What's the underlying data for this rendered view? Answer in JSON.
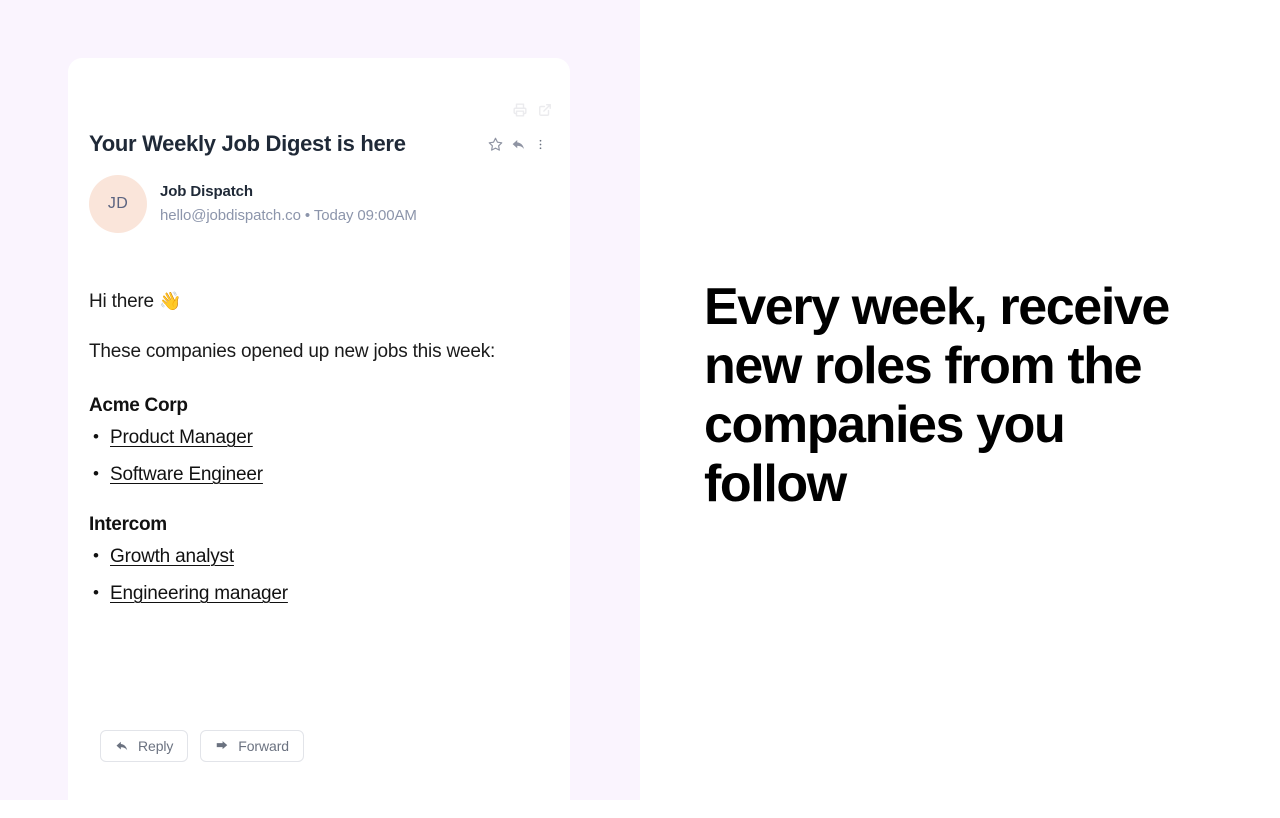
{
  "theme": {
    "left_background": "#faf4fe",
    "right_background": "#ffffff",
    "card_background": "#ffffff",
    "avatar_background": "#fae5da",
    "avatar_text_color": "#5b6480",
    "title_color": "#1f2937",
    "muted_text_color": "#8c95ab",
    "body_text_color": "#1a1a1a",
    "headline_color": "#000000",
    "button_border_color": "#e2e4e9",
    "button_text_color": "#6b7280",
    "utility_icon_color": "#ebebee"
  },
  "email": {
    "title": "Your Weekly Job Digest is here",
    "utility_actions": [
      {
        "name": "print-icon",
        "label": "Print"
      },
      {
        "name": "open-in-new-icon",
        "label": "Open in new window"
      }
    ],
    "title_actions": [
      {
        "name": "star-icon",
        "label": "Star"
      },
      {
        "name": "reply-arrow-icon",
        "label": "Reply"
      },
      {
        "name": "more-options-icon",
        "label": "More options"
      }
    ],
    "sender": {
      "initials": "JD",
      "name": "Job Dispatch",
      "address": "hello@jobdispatch.co",
      "separator": "•",
      "timestamp": "Today 09:00AM",
      "meta_line": "hello@jobdispatch.co • Today 09:00AM"
    },
    "body": {
      "greeting_text": "Hi there",
      "greeting_emoji": "👋",
      "intro": "These companies opened up new jobs this week:",
      "companies": [
        {
          "name": "Acme Corp",
          "jobs": [
            "Product Manager",
            "Software Engineer"
          ]
        },
        {
          "name": "Intercom",
          "jobs": [
            "Growth analyst",
            "Engineering manager"
          ]
        }
      ]
    },
    "footer": {
      "reply_label": "Reply",
      "forward_label": "Forward"
    }
  },
  "promo": {
    "headline": "Every week, receive new roles from the companies you follow"
  }
}
